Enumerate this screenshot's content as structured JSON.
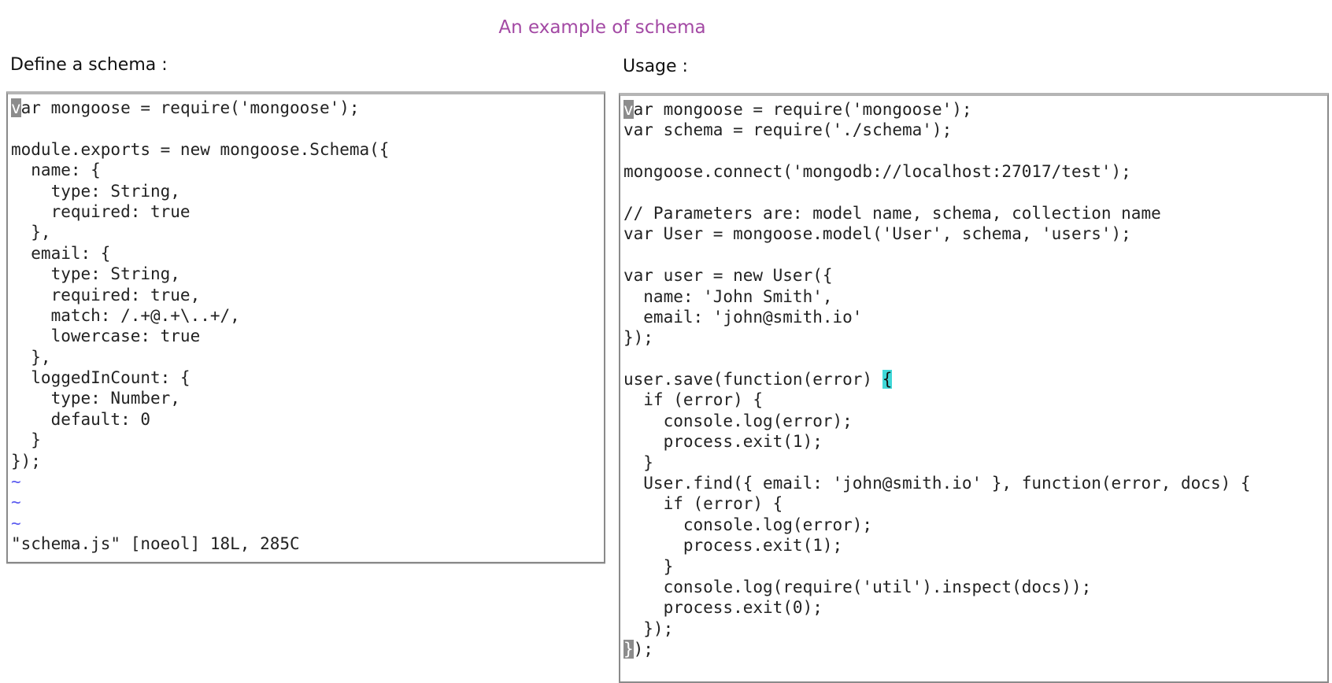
{
  "slide": {
    "title": "An example of schema"
  },
  "left_panel": {
    "label": "Define a schema :",
    "status_line": "\"schema.js\" [noeol] 18L, 285C",
    "tilde": "~",
    "lines": [
      "ar mongoose = require('mongoose');",
      "",
      "module.exports = new mongoose.Schema({",
      "  name: {",
      "    type: String,",
      "    required: true",
      "  },",
      "  email: {",
      "    type: String,",
      "    required: true,",
      "    match: /.+@.+\\..+/,",
      "    lowercase: true",
      "  },",
      "  loggedInCount: {",
      "    type: Number,",
      "    default: 0",
      "  }",
      "});"
    ],
    "first_char": "v"
  },
  "right_panel": {
    "label": "Usage :",
    "first_char": "v",
    "first_line_rest": "ar mongoose = require('mongoose');",
    "lines": [
      "var schema = require('./schema');",
      "",
      "mongoose.connect('mongodb://localhost:27017/test');",
      "",
      "// Parameters are: model name, schema, collection name",
      "var User = mongoose.model('User', schema, 'users');",
      "",
      "var user = new User({",
      "  name: 'John Smith',",
      "  email: 'john@smith.io'",
      "});",
      ""
    ],
    "save_line_prefix": "user.save(function(error) ",
    "save_line_brace": "{",
    "lines_after_save": [
      "  if (error) {",
      "    console.log(error);",
      "    process.exit(1);",
      "  }",
      "  User.find({ email: 'john@smith.io' }, function(error, docs) {",
      "    if (error) {",
      "      console.log(error);",
      "      process.exit(1);",
      "    }",
      "    console.log(require('util').inspect(docs));",
      "    process.exit(0);",
      "  });"
    ],
    "last_line_cursor": "}",
    "last_line_rest": ");"
  }
}
